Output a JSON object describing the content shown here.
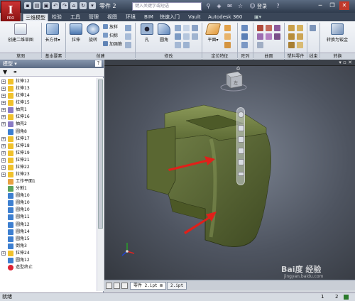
{
  "app": {
    "logo_letter": "I",
    "logo_sub": "PRO",
    "doc_title": "零件 2",
    "search_placeholder": "键入关键字或短语",
    "login": "登录"
  },
  "tabs": [
    "三维模型",
    "检验",
    "工具",
    "管理",
    "视图",
    "环境",
    "BIM",
    "快速入门",
    "Vault",
    "Autodesk 360"
  ],
  "active_tab": "三维模型",
  "ribbon": {
    "sketch_btn": "创建二维草图",
    "extrude_btn": "拉伸",
    "revolve_btn": "旋转",
    "loft": "放样",
    "sweep": "扫掠",
    "rib": "加强筋",
    "box_btn": "长方体",
    "hole_btn": "孔",
    "fillet_btn": "圆角",
    "plane_btn": "平面",
    "convert_btn": "转换为钣金",
    "groups": [
      "草图",
      "基本要素",
      "创建",
      "修改",
      "定位特征",
      "阵列",
      "曲面",
      "塑料零件",
      "线束",
      "转换"
    ]
  },
  "browser": {
    "title": "模型",
    "items": [
      {
        "label": "拉伸12",
        "type": "feature",
        "expand": "+"
      },
      {
        "label": "拉伸13",
        "type": "feature",
        "expand": "+"
      },
      {
        "label": "拉伸14",
        "type": "feature",
        "expand": "+"
      },
      {
        "label": "拉伸15",
        "type": "feature",
        "expand": "+"
      },
      {
        "label": "抽壳1",
        "type": "shell",
        "expand": "+"
      },
      {
        "label": "拉伸16",
        "type": "feature",
        "expand": "+"
      },
      {
        "label": "抽壳2",
        "type": "shell",
        "expand": "+"
      },
      {
        "label": "圆角8",
        "type": "fillet",
        "expand": ""
      },
      {
        "label": "拉伸17",
        "type": "feature",
        "expand": "+"
      },
      {
        "label": "拉伸18",
        "type": "feature",
        "expand": "+"
      },
      {
        "label": "拉伸19",
        "type": "feature",
        "expand": "+"
      },
      {
        "label": "拉伸21",
        "type": "feature",
        "expand": "+"
      },
      {
        "label": "拉伸22",
        "type": "feature",
        "expand": "+"
      },
      {
        "label": "拉伸23",
        "type": "feature",
        "expand": "+"
      },
      {
        "label": "工作平面1",
        "type": "plane",
        "expand": ""
      },
      {
        "label": "分割1",
        "type": "split",
        "expand": ""
      },
      {
        "label": "圆角10",
        "type": "fillet",
        "expand": ""
      },
      {
        "label": "圆角10",
        "type": "fillet",
        "expand": ""
      },
      {
        "label": "圆角10",
        "type": "fillet",
        "expand": ""
      },
      {
        "label": "圆角11",
        "type": "fillet",
        "expand": ""
      },
      {
        "label": "圆角12",
        "type": "fillet",
        "expand": ""
      },
      {
        "label": "圆角14",
        "type": "fillet",
        "expand": ""
      },
      {
        "label": "圆角15",
        "type": "fillet",
        "expand": ""
      },
      {
        "label": "倒角3",
        "type": "chamfer",
        "expand": ""
      },
      {
        "label": "拉伸24",
        "type": "feature",
        "expand": "+"
      },
      {
        "label": "圆角12",
        "type": "fillet",
        "expand": ""
      },
      {
        "label": "造型终止",
        "type": "end",
        "expand": ""
      }
    ]
  },
  "doc_tabs": [
    "零件 2.ipt",
    "2.ipt"
  ],
  "status": {
    "text": "就绪",
    "count_a": "1",
    "count_b": "2"
  },
  "watermark": {
    "line1": "Bai度 经验",
    "line2": "jingyan.baidu.com"
  },
  "colors": {
    "part": "#5b6b37",
    "arrow": "#e0201a",
    "accent": "#3a4658"
  }
}
